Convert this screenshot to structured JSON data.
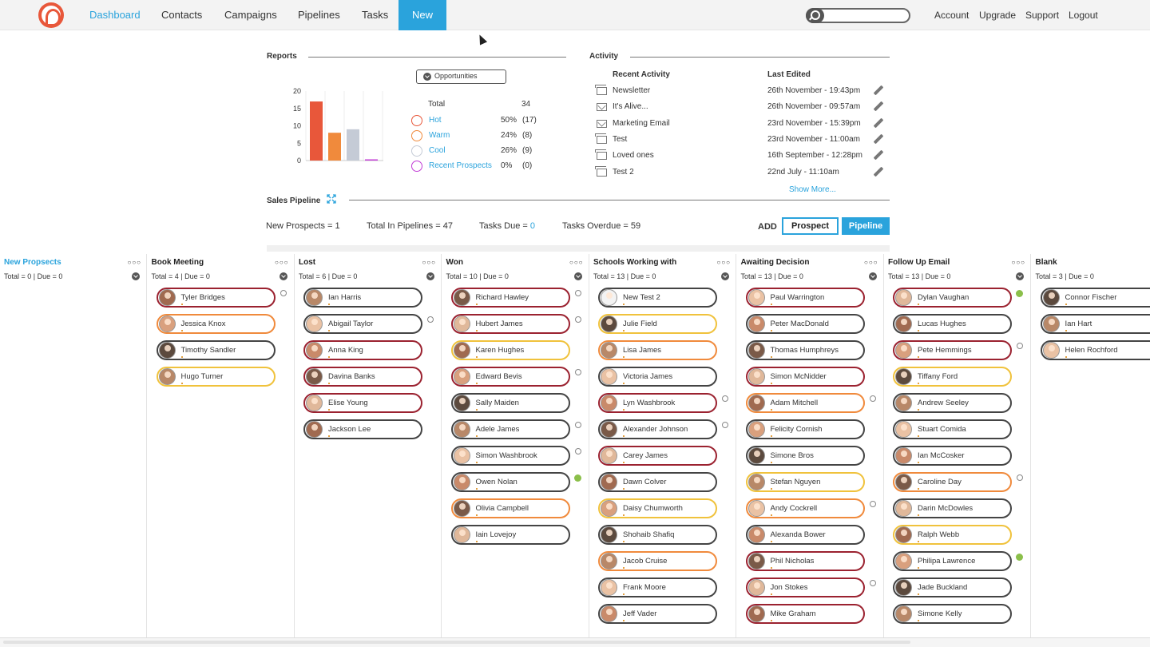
{
  "nav": {
    "items": [
      "Dashboard",
      "Contacts",
      "Campaigns",
      "Pipelines",
      "Tasks",
      "New"
    ],
    "right": [
      "Account",
      "Upgrade",
      "Support",
      "Logout"
    ],
    "search_placeholder": ""
  },
  "reports": {
    "title": "Reports",
    "filter_label": "Opportunities",
    "total_label": "Total",
    "total_value": "34",
    "rows": [
      {
        "label": "Hot",
        "pct": "50%",
        "count": "(17)",
        "color": "#e8573a"
      },
      {
        "label": "Warm",
        "pct": "24%",
        "count": "(8)",
        "color": "#f08a3c"
      },
      {
        "label": "Cool",
        "pct": "26%",
        "count": "(9)",
        "color": "#c5cbd6"
      },
      {
        "label": "Recent Prospects",
        "pct": "0%",
        "count": "(0)",
        "color": "#c23cd6"
      }
    ]
  },
  "chart_data": {
    "type": "bar",
    "categories": [
      "Hot",
      "Warm",
      "Cool",
      "Recent Prospects"
    ],
    "values": [
      17,
      8,
      9,
      0
    ],
    "colors": [
      "#e8573a",
      "#f08a3c",
      "#c5cbd6",
      "#c23cd6"
    ],
    "ylim": [
      0,
      20
    ],
    "yticks": [
      "20",
      "15",
      "10",
      "5",
      "0"
    ],
    "title": "",
    "xlabel": "",
    "ylabel": ""
  },
  "activity": {
    "title": "Activity",
    "col_recent": "Recent Activity",
    "col_edited": "Last Edited",
    "rows": [
      {
        "icon": "folder",
        "name": "Newsletter",
        "date": "26th November - 19:43pm"
      },
      {
        "icon": "mail",
        "name": "It's Alive...",
        "date": "26th November - 09:57am"
      },
      {
        "icon": "mail",
        "name": "Marketing Email",
        "date": "23rd November - 15:39pm"
      },
      {
        "icon": "folder",
        "name": "Test",
        "date": "23rd November - 11:00am"
      },
      {
        "icon": "folder",
        "name": "Loved ones",
        "date": "16th September - 12:28pm"
      },
      {
        "icon": "folder",
        "name": "Test 2",
        "date": "22nd July - 11:10am"
      }
    ],
    "show_more": "Show More..."
  },
  "pipeline": {
    "title": "Sales Pipeline",
    "new_prospects": "New Prospects = 1",
    "total_in_pipelines": "Total In Pipelines = 47",
    "tasks_due_label": "Tasks Due = ",
    "tasks_due_value": "0",
    "tasks_overdue": "Tasks Overdue = 59",
    "add_label": "ADD",
    "prospect_btn": "Prospect",
    "pipeline_btn": "Pipeline"
  },
  "columns": [
    {
      "title": "New Propsects",
      "blue": true,
      "total": "Total = 0 | Due = 0",
      "cards": []
    },
    {
      "title": "Book Meeting",
      "total": "Total = 4 | Due = 0",
      "cards": [
        {
          "name": "Tyler Bridges",
          "border": "#9b2230",
          "mark": "alarm"
        },
        {
          "name": "Jessica Knox",
          "border": "#f08a3c"
        },
        {
          "name": "Timothy Sandler",
          "border": "#444"
        },
        {
          "name": "Hugo Turner",
          "border": "#f0c23c"
        }
      ]
    },
    {
      "title": "Lost",
      "total": "Total = 6 | Due = 0",
      "cards": [
        {
          "name": "Ian Harris",
          "border": "#444"
        },
        {
          "name": "Abigail Taylor",
          "border": "#444",
          "mark": "alarm"
        },
        {
          "name": "Anna King",
          "border": "#9b2230"
        },
        {
          "name": "Davina Banks",
          "border": "#9b2230"
        },
        {
          "name": "Elise Young",
          "border": "#9b2230"
        },
        {
          "name": "Jackson Lee",
          "border": "#444"
        }
      ]
    },
    {
      "title": "Won",
      "total": "Total = 10 | Due = 0",
      "cards": [
        {
          "name": "Richard Hawley",
          "border": "#9b2230",
          "mark": "alarm"
        },
        {
          "name": "Hubert James",
          "border": "#9b2230",
          "mark": "alarm"
        },
        {
          "name": "Karen Hughes",
          "border": "#f0c23c"
        },
        {
          "name": "Edward Bevis",
          "border": "#9b2230",
          "mark": "alarm"
        },
        {
          "name": "Sally Maiden",
          "border": "#444"
        },
        {
          "name": "Adele James",
          "border": "#444",
          "mark": "alarm"
        },
        {
          "name": "Simon Washbrook",
          "border": "#444",
          "mark": "alarm"
        },
        {
          "name": "Owen Nolan",
          "border": "#444",
          "mark": "green"
        },
        {
          "name": "Olivia Campbell",
          "border": "#f08a3c"
        },
        {
          "name": "Iain Lovejoy",
          "border": "#444"
        }
      ]
    },
    {
      "title": "Schools Working with",
      "total": "Total = 13 | Due = 0",
      "cards": [
        {
          "name": "New Test 2",
          "border": "#444",
          "blank": true
        },
        {
          "name": "Julie Field",
          "border": "#f0c23c"
        },
        {
          "name": "Lisa James",
          "border": "#f08a3c"
        },
        {
          "name": "Victoria James",
          "border": "#444"
        },
        {
          "name": "Lyn Washbrook",
          "border": "#9b2230",
          "mark": "alarm"
        },
        {
          "name": "Alexander Johnson",
          "border": "#444",
          "mark": "alarm"
        },
        {
          "name": "Carey James",
          "border": "#9b2230"
        },
        {
          "name": "Dawn Colver",
          "border": "#444"
        },
        {
          "name": "Daisy Chumworth",
          "border": "#f0c23c"
        },
        {
          "name": "Shohaib Shafiq",
          "border": "#444"
        },
        {
          "name": "Jacob Cruise",
          "border": "#f08a3c"
        },
        {
          "name": "Frank Moore",
          "border": "#444"
        },
        {
          "name": "Jeff Vader",
          "border": "#444"
        }
      ]
    },
    {
      "title": "Awaiting Decision",
      "total": "Total = 13 | Due = 0",
      "cards": [
        {
          "name": "Paul Warrington",
          "border": "#9b2230"
        },
        {
          "name": "Peter MacDonald",
          "border": "#444"
        },
        {
          "name": "Thomas Humphreys",
          "border": "#444"
        },
        {
          "name": "Simon McNidder",
          "border": "#9b2230"
        },
        {
          "name": "Adam Mitchell",
          "border": "#f08a3c",
          "mark": "alarm"
        },
        {
          "name": "Felicity Cornish",
          "border": "#444"
        },
        {
          "name": "Simone Bros",
          "border": "#444"
        },
        {
          "name": "Stefan Nguyen",
          "border": "#f0c23c"
        },
        {
          "name": "Andy Cockrell",
          "border": "#f08a3c",
          "mark": "alarm"
        },
        {
          "name": "Alexanda Bower",
          "border": "#444"
        },
        {
          "name": "Phil Nicholas",
          "border": "#9b2230"
        },
        {
          "name": "Jon Stokes",
          "border": "#9b2230",
          "mark": "alarm"
        },
        {
          "name": "Mike Graham",
          "border": "#9b2230"
        }
      ]
    },
    {
      "title": "Follow Up Email",
      "total": "Total = 13 | Due = 0",
      "cards": [
        {
          "name": "Dylan Vaughan",
          "border": "#9b2230",
          "mark": "green"
        },
        {
          "name": "Lucas Hughes",
          "border": "#444"
        },
        {
          "name": "Pete Hemmings",
          "border": "#9b2230",
          "mark": "alarm"
        },
        {
          "name": "Tiffany Ford",
          "border": "#f0c23c"
        },
        {
          "name": "Andrew Seeley",
          "border": "#444"
        },
        {
          "name": "Stuart Comida",
          "border": "#444"
        },
        {
          "name": "Ian McCosker",
          "border": "#444"
        },
        {
          "name": "Caroline Day",
          "border": "#f08a3c",
          "mark": "alarm"
        },
        {
          "name": "Darin McDowles",
          "border": "#444"
        },
        {
          "name": "Ralph Webb",
          "border": "#f0c23c"
        },
        {
          "name": "Philipa Lawrence",
          "border": "#444",
          "mark": "green"
        },
        {
          "name": "Jade Buckland",
          "border": "#444"
        },
        {
          "name": "Simone Kelly",
          "border": "#444"
        }
      ]
    },
    {
      "title": "Blank",
      "total": "Total = 3 | Due = 0",
      "cards": [
        {
          "name": "Connor Fischer",
          "border": "#444"
        },
        {
          "name": "Ian Hart",
          "border": "#444"
        },
        {
          "name": "Helen Rochford",
          "border": "#444"
        }
      ]
    }
  ]
}
